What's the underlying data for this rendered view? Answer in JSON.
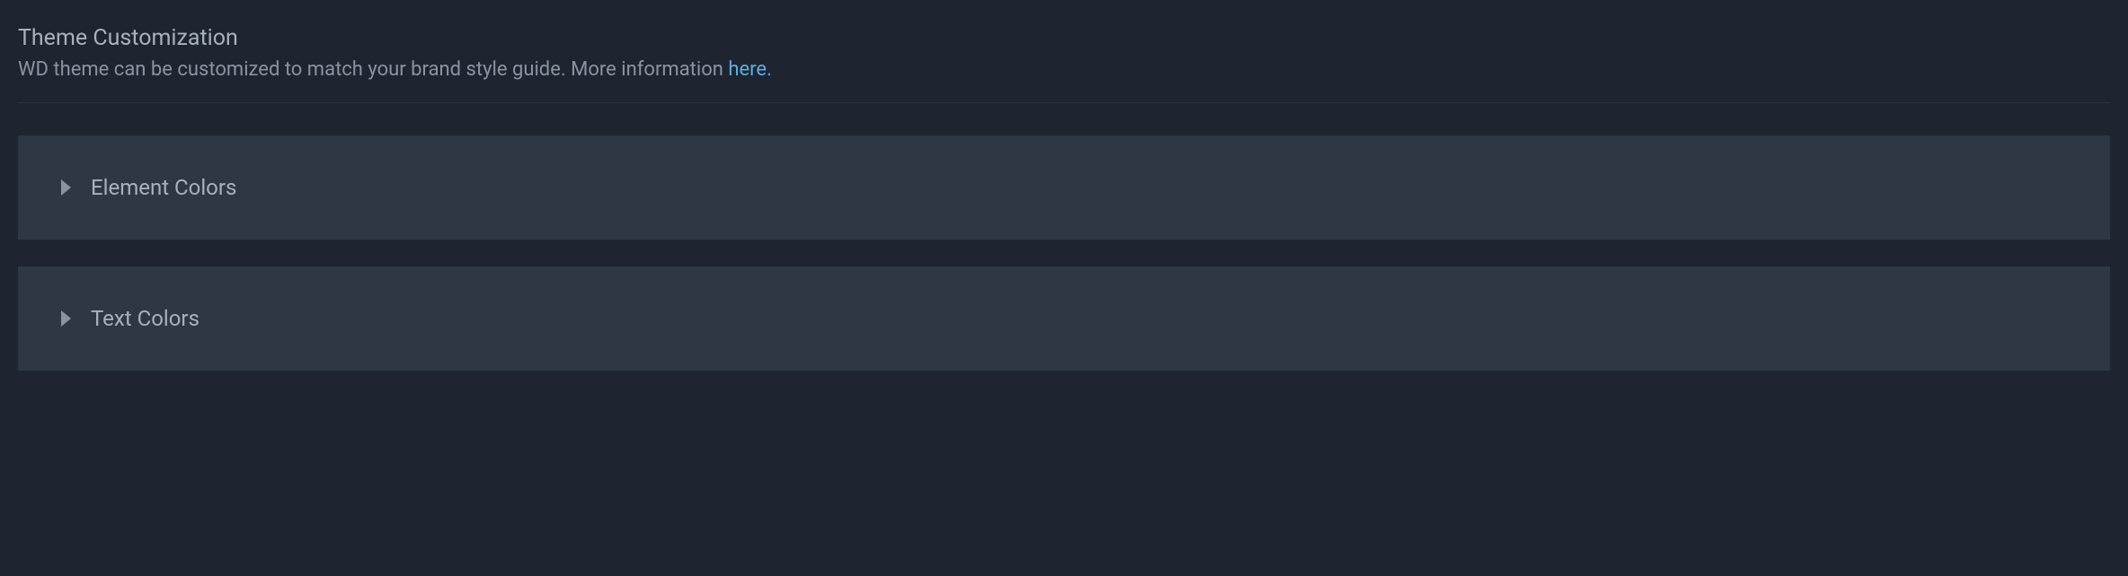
{
  "header": {
    "title": "Theme Customization",
    "description_prefix": "WD theme can be customized to match your brand style guide. More information ",
    "link_text": "here."
  },
  "accordions": [
    {
      "label": "Element Colors"
    },
    {
      "label": "Text Colors"
    }
  ]
}
